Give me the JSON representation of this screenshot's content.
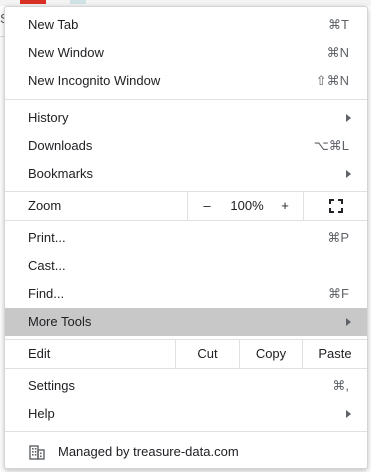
{
  "menu": {
    "new_tab": {
      "label": "New Tab",
      "shortcut": "⌘T"
    },
    "new_window": {
      "label": "New Window",
      "shortcut": "⌘N"
    },
    "new_incognito": {
      "label": "New Incognito Window",
      "shortcut": "⇧⌘N"
    },
    "history": {
      "label": "History"
    },
    "downloads": {
      "label": "Downloads",
      "shortcut": "⌥⌘L"
    },
    "bookmarks": {
      "label": "Bookmarks"
    },
    "zoom": {
      "label": "Zoom",
      "minus": "–",
      "level": "100%",
      "plus": "+"
    },
    "print": {
      "label": "Print...",
      "shortcut": "⌘P"
    },
    "cast": {
      "label": "Cast..."
    },
    "find": {
      "label": "Find...",
      "shortcut": "⌘F"
    },
    "more_tools": {
      "label": "More Tools"
    },
    "edit": {
      "label": "Edit",
      "cut": "Cut",
      "copy": "Copy",
      "paste": "Paste"
    },
    "settings": {
      "label": "Settings",
      "shortcut": "⌘,"
    },
    "help": {
      "label": "Help"
    },
    "managed": {
      "label": "Managed by treasure-data.com",
      "icon": "building-icon"
    }
  },
  "colors": {
    "highlight": "#c8c8c8",
    "separator": "#e1e1e1",
    "shortcut_text": "#5f6368"
  },
  "backdrop": {
    "left_letter": "S"
  }
}
